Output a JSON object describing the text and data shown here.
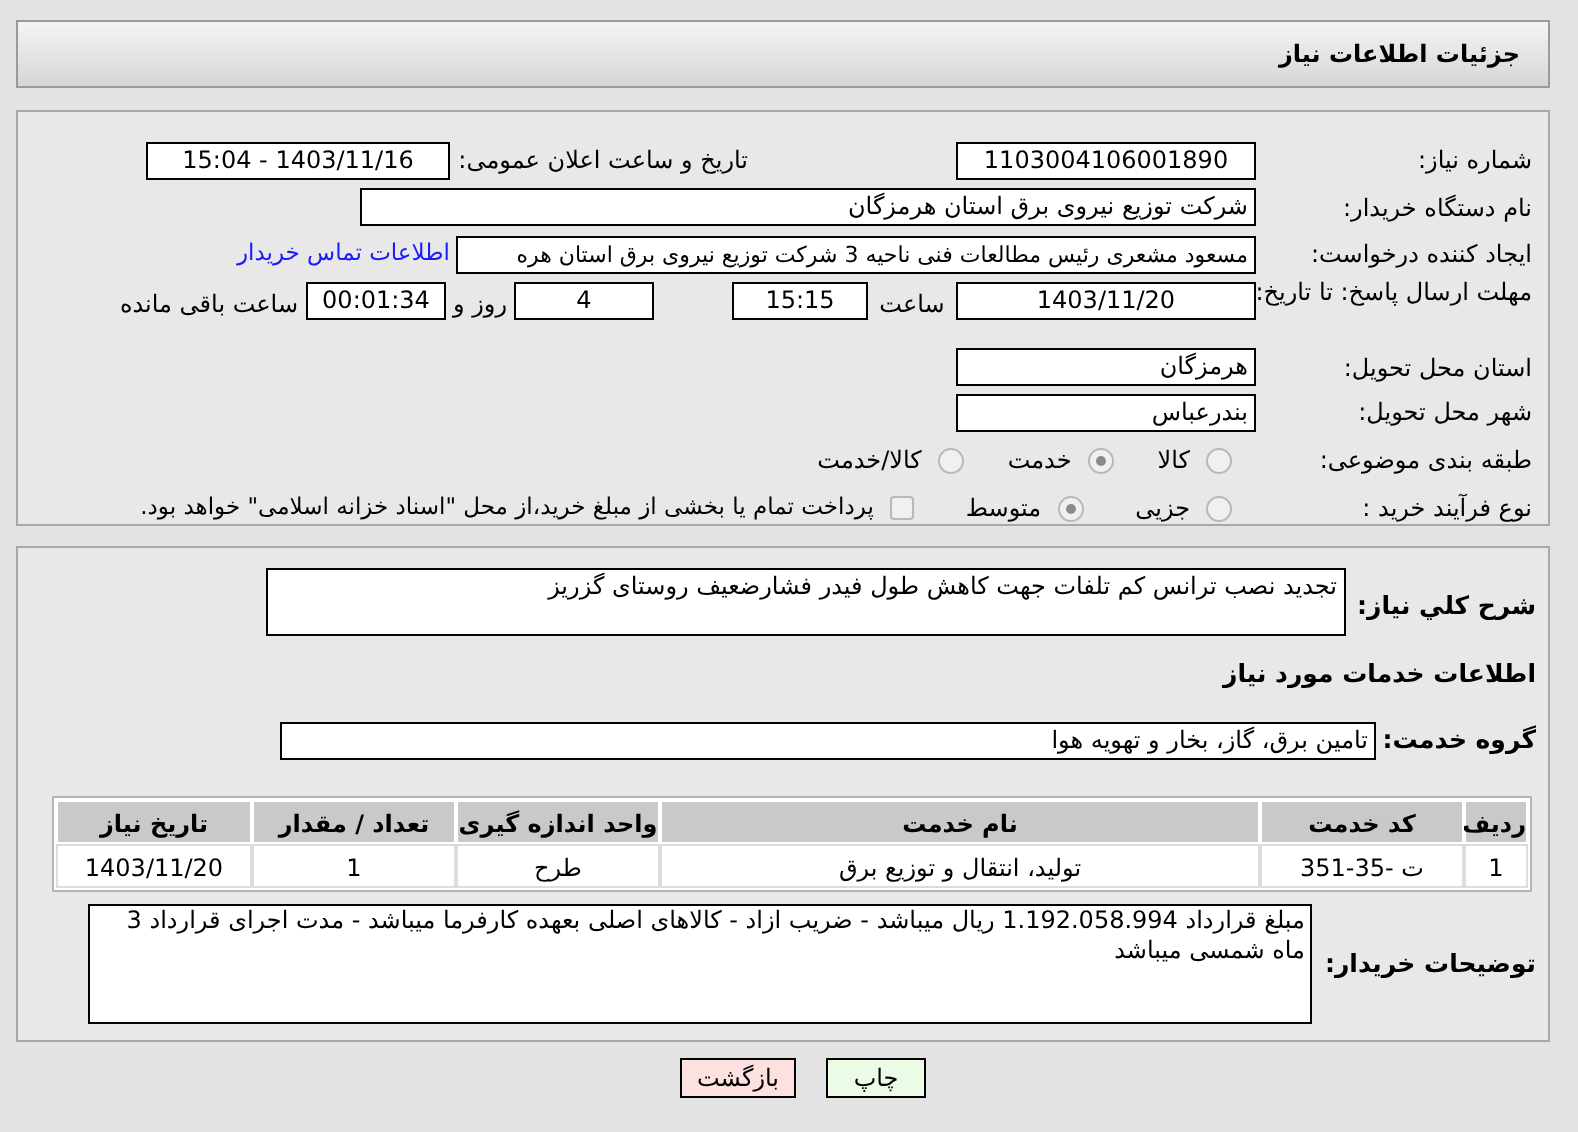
{
  "header": {
    "title": "جزئیات اطلاعات نیاز"
  },
  "need_info": {
    "need_number": {
      "label": "شماره نیاز:",
      "value": "1103004106001890"
    },
    "announce_datetime": {
      "label": "تاریخ و ساعت اعلان عمومی:",
      "value": "1403/11/16 - 15:04"
    },
    "buyer_org": {
      "label": "نام دستگاه خریدار:",
      "value": "شرکت توزیع نیروی برق استان هرمزگان"
    },
    "requester": {
      "label": "ایجاد کننده درخواست:",
      "value": "مسعود مشعری رئیس مطالعات فنی ناحیه 3 شرکت توزیع نیروی برق استان هره",
      "link": "اطلاعات تماس خریدار"
    },
    "deadline": {
      "label": "مهلت ارسال پاسخ: تا تاریخ:",
      "date": "1403/11/20",
      "time_label": "ساعت",
      "time": "15:15",
      "days": "4",
      "days_label": "روز و",
      "remaining": "00:01:34",
      "remaining_label": "ساعت باقی مانده"
    },
    "province": {
      "label": "استان محل تحویل:",
      "value": "هرمزگان"
    },
    "city": {
      "label": "شهر محل تحویل:",
      "value": "بندرعباس"
    },
    "category": {
      "label": "طبقه بندی موضوعی:",
      "options": [
        {
          "label": "کالا",
          "selected": false
        },
        {
          "label": "خدمت",
          "selected": true
        },
        {
          "label": "کالا/خدمت",
          "selected": false
        }
      ]
    },
    "purchase_process": {
      "label": "نوع فرآیند خرید :",
      "options": [
        {
          "label": "جزیی",
          "selected": false
        },
        {
          "label": "متوسط",
          "selected": true
        }
      ],
      "payment": {
        "checked": false,
        "text": "پرداخت تمام یا بخشی از مبلغ خرید،از محل \"اسناد خزانه اسلامی\" خواهد بود."
      }
    }
  },
  "services": {
    "description": {
      "label": "شرح کلي نياز:",
      "value": "تجدید نصب ترانس کم تلفات جهت کاهش طول فیدر فشارضعیف روستای گزریز"
    },
    "heading": "اطلاعات خدمات مورد نياز",
    "service_group": {
      "label": "گروه خدمت:",
      "value": "تامین برق، گاز، بخار و تهویه هوا"
    },
    "table": {
      "columns": [
        "ردیف",
        "کد خدمت",
        "نام خدمت",
        "واحد اندازه گیری",
        "تعداد / مقدار",
        "تاریخ نیاز"
      ],
      "rows": [
        [
          "1",
          "ت -35-351",
          "تولید، انتقال و توزیع برق",
          "طرح",
          "1",
          "1403/11/20"
        ]
      ]
    },
    "buyer_notes": {
      "label": "توضیحات خریدار:",
      "value": "مبلغ قرارداد 1.192.058.994 ریال میباشد - ضریب ازاد - کالاهای اصلی بعهده کارفرما میباشد - مدت اجرای قرارداد 3 ماه شمسی میباشد"
    }
  },
  "buttons": [
    {
      "label": "چاپ",
      "kind": "print"
    },
    {
      "label": "بازگشت",
      "kind": "back"
    }
  ]
}
